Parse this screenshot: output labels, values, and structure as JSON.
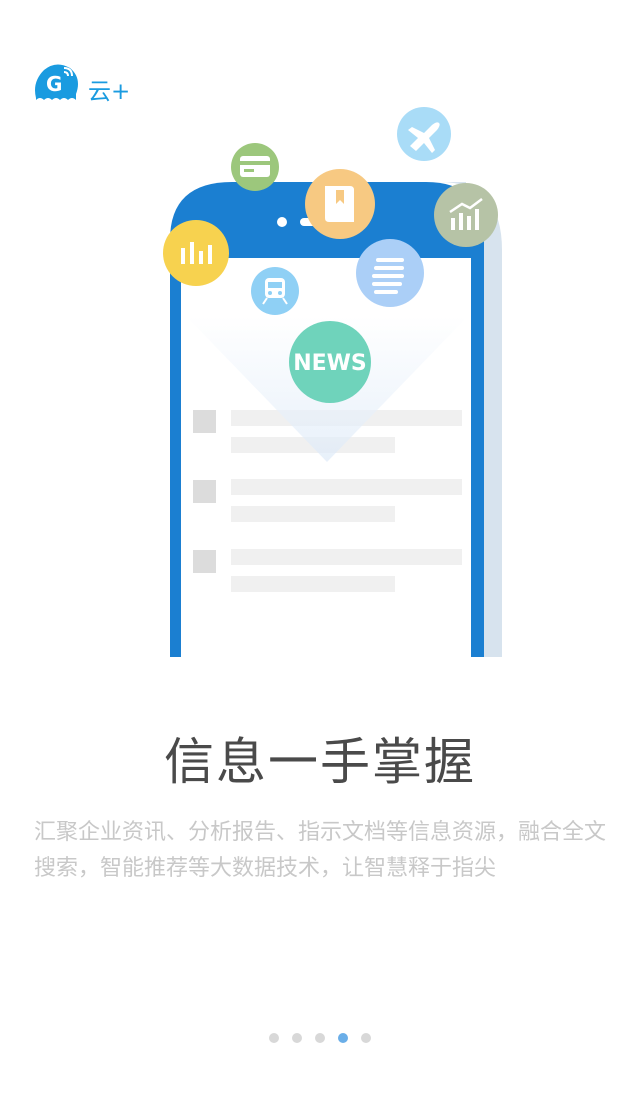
{
  "brand": {
    "name": "云+"
  },
  "illustration": {
    "news_label": "NEWS"
  },
  "headline": "信息一手掌握",
  "description": "汇聚企业资讯、分析报告、指示文档等信息资源，融合全文搜索，智能推荐等大数据技术，让智慧释于指尖",
  "pager": {
    "total": 5,
    "active_index": 3
  },
  "colors": {
    "brand_blue": "#1a9be0",
    "phone_blue": "#1b7fd1",
    "news_green": "#6fd3bb",
    "active_dot": "#6aaee8",
    "inactive_dot": "#d8d8d8"
  }
}
